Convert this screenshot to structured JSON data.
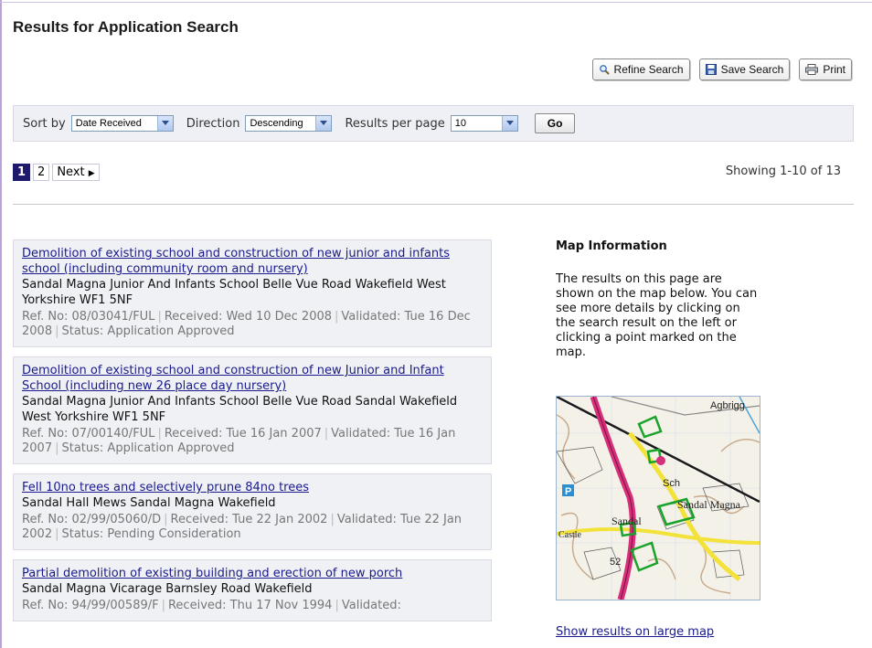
{
  "page": {
    "title": "Results for Application Search"
  },
  "toolbar": {
    "refine_label": "Refine Search",
    "save_label": "Save Search",
    "print_label": "Print"
  },
  "sort": {
    "sort_by_label": "Sort by",
    "sort_by_value": "Date Received",
    "direction_label": "Direction",
    "direction_value": "Descending",
    "per_page_label": "Results per page",
    "per_page_value": "10",
    "go_label": "Go"
  },
  "pagination": {
    "pages": [
      "1",
      "2"
    ],
    "next_label": "Next",
    "showing": "Showing 1-10 of 13"
  },
  "results": [
    {
      "title": "Demolition of existing school and construction of new junior and infants school (including community room and nursery)",
      "address": "Sandal Magna Junior And Infants School Belle Vue Road Wakefield West Yorkshire WF1 5NF",
      "ref": "Ref. No: 08/03041/FUL",
      "received": "Received: Wed 10 Dec 2008",
      "validated": "Validated: Tue 16 Dec 2008",
      "status": "Status: Application Approved"
    },
    {
      "title": "Demolition of existing school and construction of new Junior and Infant School (including new 26 place day nursery)",
      "address": "Sandal Magna Junior And Infants School Belle Vue Road Sandal Wakefield West Yorkshire WF1 5NF",
      "ref": "Ref. No: 07/00140/FUL",
      "received": "Received: Tue 16 Jan 2007",
      "validated": "Validated: Tue 16 Jan 2007",
      "status": "Status: Application Approved"
    },
    {
      "title": "Fell 10no trees and selectively prune 84no trees",
      "address": "Sandal Hall Mews Sandal Magna Wakefield",
      "ref": "Ref. No: 02/99/05060/D",
      "received": "Received: Tue 22 Jan 2002",
      "validated": "Validated: Tue 22 Jan 2002",
      "status": "Status: Pending Consideration"
    },
    {
      "title": "Partial demolition of existing building and erection of new porch",
      "address": "Sandal Magna Vicarage Barnsley Road Wakefield",
      "ref": "Ref. No: 94/99/00589/F",
      "received": "Received: Thu 17 Nov 1994",
      "validated": "Validated:",
      "status": ""
    }
  ],
  "map_info": {
    "heading": "Map Information",
    "text": "The results on this page are shown on the map below. You can see more details by clicking on the search result on the left or clicking a point marked on the map.",
    "map_labels": {
      "agbrigg": "Agbrigg",
      "sch": "Sch",
      "sandal": "Sandal",
      "sandal_magna": "Sandal Magna",
      "castle": "Castle",
      "parking": "P",
      "spot_height": "52"
    },
    "large_map_link": "Show results on large map"
  },
  "colors": {
    "link": "#1a1a8c",
    "current_page": "#1d1a6e",
    "panel_bg": "#eff1f5",
    "road_pink": "#d6307a",
    "road_yellow": "#f2e23a",
    "marker_green": "#1aa32a"
  }
}
